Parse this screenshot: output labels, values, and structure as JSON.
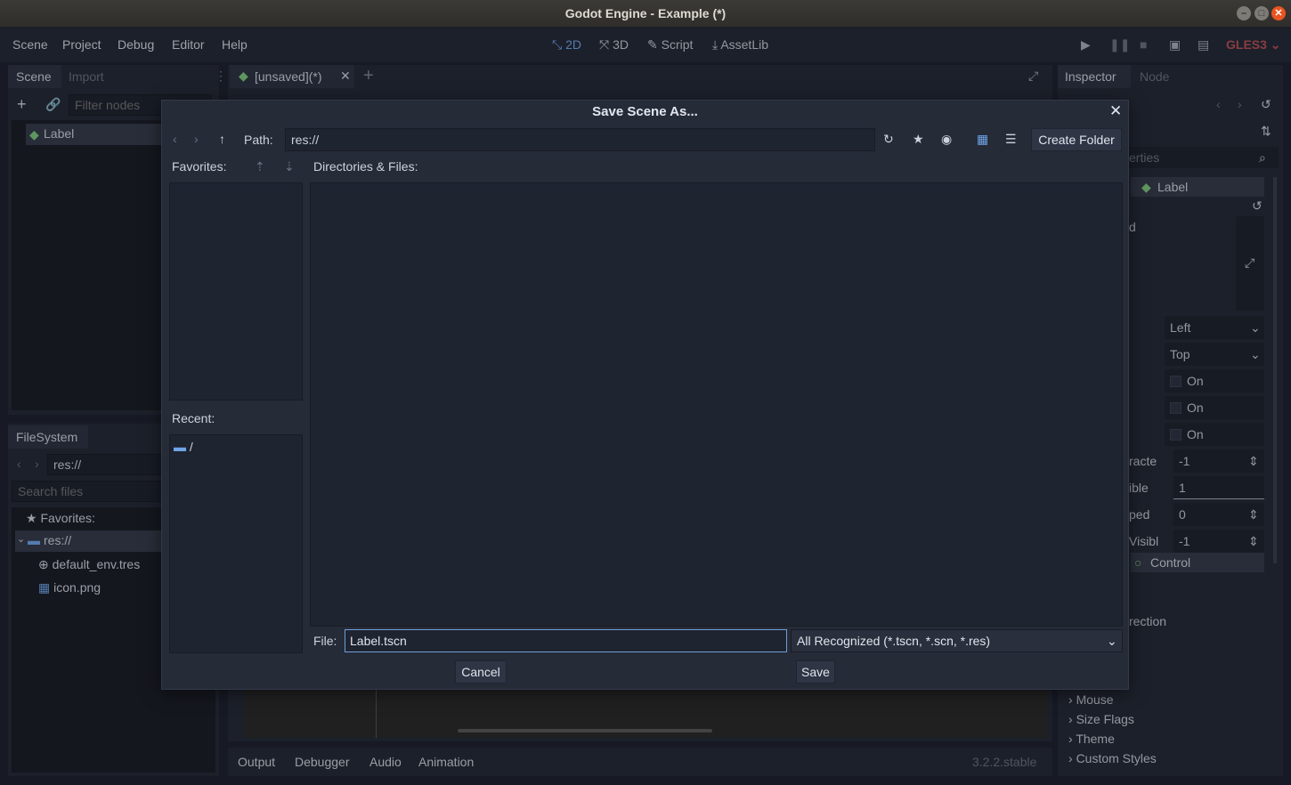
{
  "window": {
    "title": "Godot Engine - Example (*)"
  },
  "menu": [
    "Scene",
    "Project",
    "Debug",
    "Editor",
    "Help"
  ],
  "workspaces": [
    {
      "label": "2D",
      "icon": "2d-icon"
    },
    {
      "label": "3D",
      "icon": "3d-icon"
    },
    {
      "label": "Script",
      "icon": "script-icon"
    },
    {
      "label": "AssetLib",
      "icon": "assetlib-icon"
    }
  ],
  "renderer": "GLES3",
  "scene_dock": {
    "tabs": [
      "Scene",
      "Import"
    ],
    "filter_placeholder": "Filter nodes",
    "root_node": "Label"
  },
  "filesystem_dock": {
    "tab": "FileSystem",
    "path": "res://",
    "search_placeholder": "Search files",
    "items": [
      "Favorites:",
      "res://",
      "default_env.tres",
      "icon.png"
    ]
  },
  "editor_tab": {
    "label": "[unsaved](*)"
  },
  "inspector": {
    "tabs": [
      "Inspector",
      "Node"
    ],
    "filter_fragment": "erties",
    "node_label": "Label",
    "frag_d": "d",
    "align": "Left",
    "valign": "Top",
    "checks": [
      "On",
      "On",
      "On"
    ],
    "frag_characters": "racte",
    "characters_value": "-1",
    "frag_visible": "ible",
    "visible_value": "1",
    "frag_skipped": "ped",
    "skipped_value": "0",
    "frag_max_visible": "Visibl",
    "max_visible_value": "-1",
    "control_label": "Control",
    "frag_direction": "rection",
    "sections": [
      "Mouse",
      "Size Flags",
      "Theme",
      "Custom Styles"
    ]
  },
  "bottom_panel": {
    "tabs": [
      "Output",
      "Debugger",
      "Audio",
      "Animation"
    ],
    "version": "3.2.2.stable"
  },
  "dialog": {
    "title": "Save Scene As...",
    "path_label": "Path:",
    "path_value": "res://",
    "create_folder": "Create Folder",
    "favorites_label": "Favorites:",
    "recent_label": "Recent:",
    "recent_items": [
      "/"
    ],
    "files_label": "Directories & Files:",
    "file_label": "File:",
    "file_value": "Label.tscn",
    "filter_value": "All Recognized (*.tscn, *.scn, *.res)",
    "cancel": "Cancel",
    "save": "Save"
  }
}
